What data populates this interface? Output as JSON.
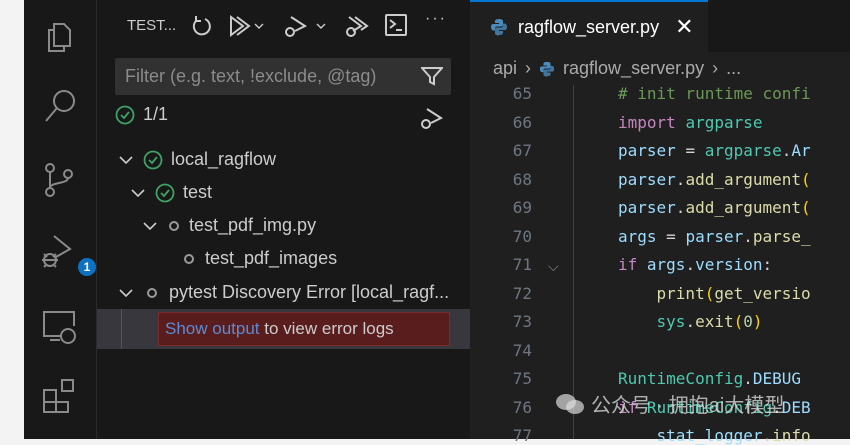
{
  "activity_bar": {
    "items": [
      "explorer",
      "search",
      "source-control",
      "run-and-debug",
      "remote-explorer",
      "extensions"
    ],
    "debug_badge": "1"
  },
  "sidebar": {
    "title": "TEST...",
    "filter_placeholder": "Filter (e.g. text, !exclude, @tag)",
    "status_count": "1/1",
    "tree": [
      {
        "label": "local_ragflow"
      },
      {
        "label": "test"
      },
      {
        "label": "test_pdf_img.py"
      },
      {
        "label": "test_pdf_images"
      },
      {
        "label": "pytest Discovery Error [local_ragf..."
      }
    ],
    "error": {
      "link": "Show output",
      "text": " to view error logs"
    }
  },
  "editor": {
    "tab": "ragflow_server.py",
    "breadcrumb": [
      "api",
      "ragflow_server.py",
      "..."
    ],
    "lines": [
      {
        "n": "65",
        "t": "# init runtime confi"
      },
      {
        "n": "66",
        "t": "import argparse"
      },
      {
        "n": "67",
        "t": "parser = argparse.Ar"
      },
      {
        "n": "68",
        "t": "parser.add_argument("
      },
      {
        "n": "69",
        "t": "parser.add_argument("
      },
      {
        "n": "70",
        "t": "args = parser.parse_"
      },
      {
        "n": "71",
        "t": "if args.version:"
      },
      {
        "n": "72",
        "t": "    print(get_versio"
      },
      {
        "n": "73",
        "t": "    sys.exit(0)"
      },
      {
        "n": "74",
        "t": ""
      },
      {
        "n": "75",
        "t": "RuntimeConfig.DEBUG"
      },
      {
        "n": "76",
        "t": "if RuntimeConfig.DEB"
      },
      {
        "n": "77",
        "t": "    stat_logger.info"
      }
    ]
  },
  "watermark": "公众号 · 拥抱ai大模型"
}
